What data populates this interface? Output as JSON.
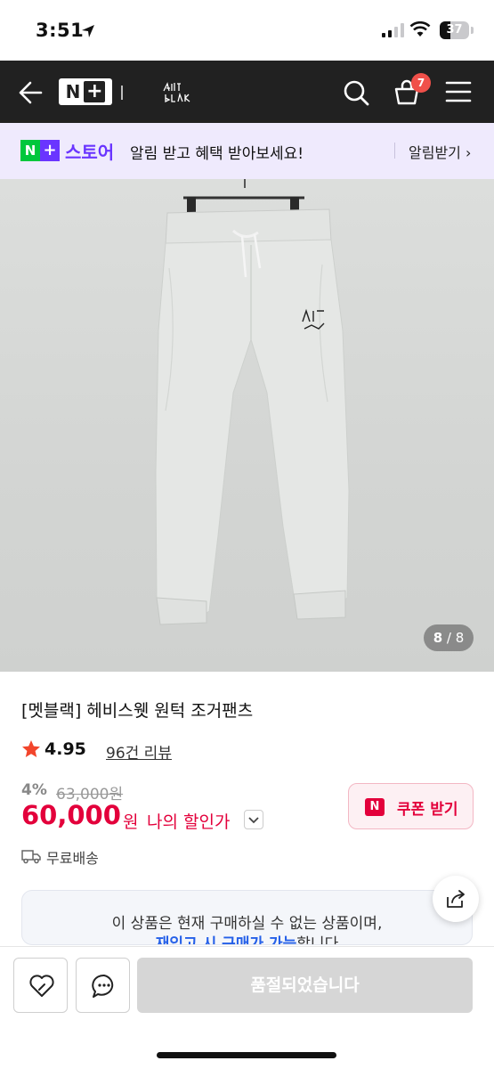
{
  "status_bar": {
    "time": "3:51",
    "battery": "37"
  },
  "header": {
    "nplus_label": "N",
    "cart_count": "7"
  },
  "promo": {
    "logo_n": "N",
    "logo_plus": "+",
    "store_label": "스토어",
    "message": "알림 받고 혜택 받아보세요!",
    "action_label": "알림받기 ›"
  },
  "gallery": {
    "current": "8",
    "separator": " / ",
    "total": "8"
  },
  "product": {
    "title": "[멧블랙] 헤비스웻 원턱 조거팬츠",
    "rating": "4.95",
    "review_link": "96건 리뷰",
    "discount_rate": "4%",
    "original_price": "63,000원",
    "price": "60,000",
    "price_unit": "원",
    "my_discount_label": "나의 할인가",
    "coupon_badge": "N",
    "coupon_label": "쿠폰 받기",
    "shipping": "무료배송"
  },
  "notice": {
    "line1": "이 상품은 현재 구매하실 수 없는 상품이며,",
    "line2_highlight": "재입고 시 구매가 가능",
    "line2_rest": "합니다"
  },
  "actions": {
    "soldout_label": "품절되었습니다"
  },
  "colors": {
    "accent_red": "#e3003b",
    "naver_green": "#00c73c",
    "naver_purple": "#6a35ff",
    "header_bg": "#212121"
  },
  "icons": [
    "back-arrow-icon",
    "search-icon",
    "cart-icon",
    "menu-icon",
    "star-icon",
    "truck-icon",
    "share-icon",
    "heart-icon",
    "chat-icon"
  ]
}
